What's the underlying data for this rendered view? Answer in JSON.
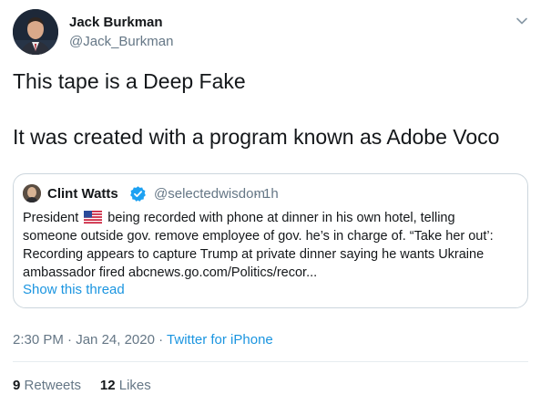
{
  "author": {
    "name": "Jack Burkman",
    "handle": "@Jack_Burkman"
  },
  "tweet": {
    "line1": "This tape is a Deep Fake",
    "line2": "It was created with a program known as Adobe Voco"
  },
  "quoted": {
    "name": "Clint Watts",
    "handle": "@selectedwisdom",
    "separator": "·",
    "time": "1h",
    "text_line1_before_flag": "President",
    "text_line1_after_flag": "being recorded with phone at dinner in his own hotel, telling",
    "text_line2": "someone outside gov. remove employee of gov. he’s in charge of. “Take her out’:",
    "text_line3": "Recording appears to capture Trump at private dinner saying he wants Ukraine",
    "text_line4": "ambassador fired abcnews.go.com/Politics/recor...",
    "show_thread": "Show this thread",
    "flag_icon": "us-flag-icon",
    "verified_color": "#1da1f2"
  },
  "meta": {
    "time": "2:30 PM",
    "sep1": "·",
    "date": "Jan 24, 2020",
    "sep2": "·",
    "source": "Twitter for iPhone"
  },
  "stats": {
    "retweets_count": "9",
    "retweets_label": "Retweets",
    "likes_count": "12",
    "likes_label": "Likes"
  },
  "colors": {
    "link": "#1b95e0",
    "secondary": "#657786",
    "border": "#ccd6dd"
  }
}
